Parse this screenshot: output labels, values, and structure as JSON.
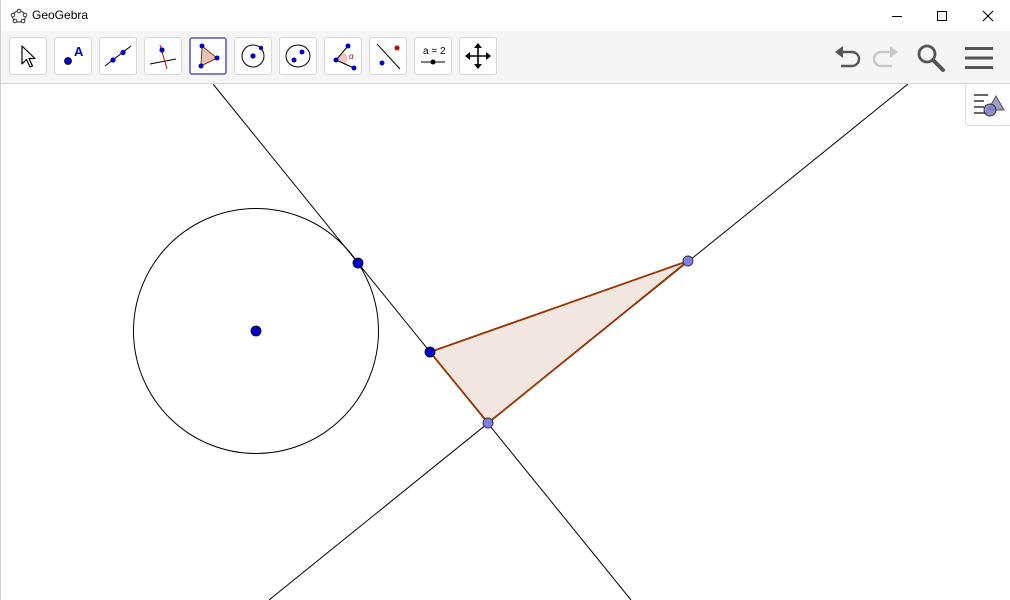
{
  "window": {
    "title": "GeoGebra",
    "icons": {
      "app": "geogebra-logo-icon",
      "minimize": "minimize-icon",
      "maximize": "maximize-icon",
      "close": "close-icon"
    }
  },
  "toolbar": {
    "tools": [
      {
        "name": "move-tool",
        "icon": "cursor-arrow-icon",
        "selected": false
      },
      {
        "name": "point-tool",
        "icon": "point-icon",
        "label": "A",
        "selected": false
      },
      {
        "name": "line-tool",
        "icon": "line-through-two-points-icon",
        "selected": false
      },
      {
        "name": "perpendicular-line-tool",
        "icon": "perpendicular-line-icon",
        "selected": false
      },
      {
        "name": "polygon-tool",
        "icon": "polygon-icon",
        "selected": true
      },
      {
        "name": "circle-center-point-tool",
        "icon": "circle-with-center-icon",
        "selected": false
      },
      {
        "name": "ellipse-tool",
        "icon": "ellipse-icon",
        "selected": false
      },
      {
        "name": "angle-tool",
        "icon": "angle-icon",
        "label": "α",
        "selected": false
      },
      {
        "name": "reflect-tool",
        "icon": "reflect-about-line-icon",
        "selected": false
      },
      {
        "name": "slider-tool",
        "icon": "slider-icon",
        "label": "a = 2",
        "selected": false
      },
      {
        "name": "move-graphics-view-tool",
        "icon": "move-arrows-icon",
        "selected": false
      }
    ],
    "right": {
      "undo": "undo-icon",
      "redo": "redo-icon",
      "search": "search-icon",
      "menu": "hamburger-menu-icon"
    }
  },
  "graphics": {
    "colors": {
      "line": "#000000",
      "point_free": "#0000cc",
      "point_dependent": "#8080e6",
      "polygon_stroke": "#993300",
      "polygon_fill": "#f2e6e1"
    }
  },
  "stylebar": {
    "icon": "style-bar-toggle-icon"
  }
}
